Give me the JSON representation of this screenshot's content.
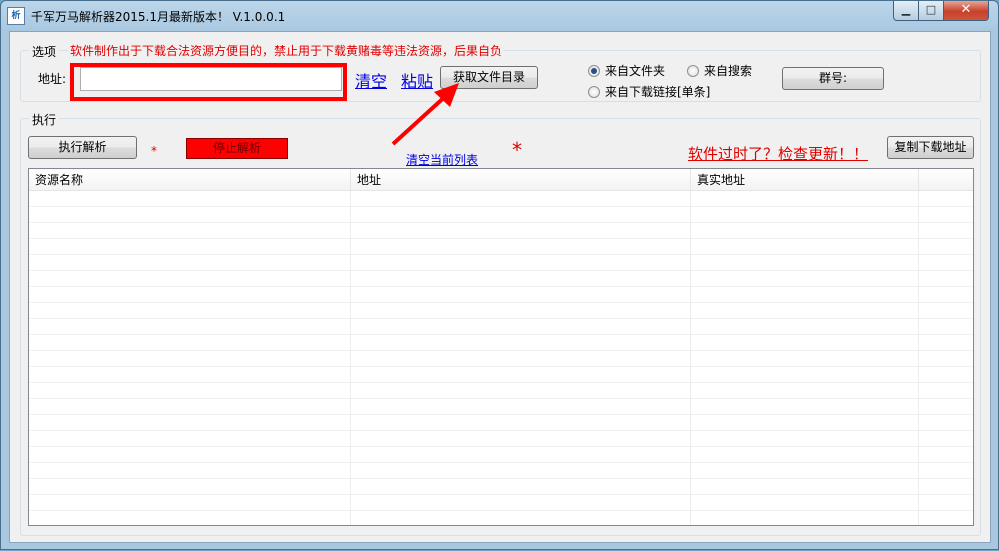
{
  "window": {
    "title": "千军万马解析器2015.1月最新版本！ V.1.0.0.1",
    "icon_name": "app-icon",
    "icon_glyph": "析",
    "minimize_glyph": "▁",
    "maximize_glyph": "□",
    "close_glyph": "✕"
  },
  "options": {
    "legend": "选项",
    "warning": "软件制作出于下载合法资源方便目的，禁止用于下载黄赌毒等违法资源，后果自负",
    "address_label": "地址:",
    "address_value": "",
    "clear_link": "清空",
    "paste_link": "粘贴",
    "get_dir_button": "获取文件目录",
    "radios": [
      {
        "label": "来自文件夹",
        "checked": true
      },
      {
        "label": "来自搜索",
        "checked": false
      },
      {
        "label": "来自下载链接[单条]",
        "checked": false
      }
    ],
    "group_button": "群号:"
  },
  "execute": {
    "legend": "执行",
    "run_button": "执行解析",
    "stop_button": "停止解析",
    "asterisk_small": "*",
    "clear_list_link": "清空当前列表",
    "asterisk_big": "*",
    "update_link": "软件过时了？检查更新！！",
    "copy_button": "复制下载地址"
  },
  "table": {
    "columns": [
      "资源名称",
      "地址",
      "真实地址",
      ""
    ]
  },
  "colors": {
    "annotation_red": "#ff0000",
    "link_blue": "#0000e0",
    "warning_red": "#e00000"
  }
}
